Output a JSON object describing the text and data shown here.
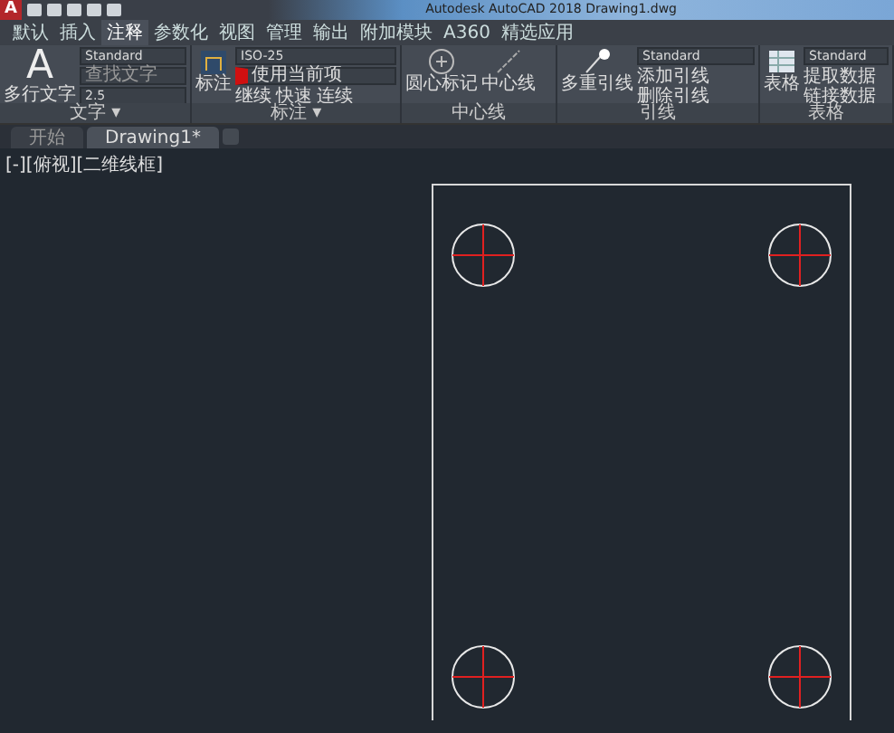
{
  "window": {
    "title": "Autodesk AutoCAD 2018    Drawing1.dwg",
    "app_button": "A"
  },
  "ribbon_tabs": [
    {
      "label": "默认",
      "selected": false
    },
    {
      "label": "插入",
      "selected": false
    },
    {
      "label": "注释",
      "selected": true
    },
    {
      "label": "参数化",
      "selected": false
    },
    {
      "label": "视图",
      "selected": false
    },
    {
      "label": "管理",
      "selected": false
    },
    {
      "label": "输出",
      "selected": false
    },
    {
      "label": "附加模块",
      "selected": false
    },
    {
      "label": "A360",
      "selected": false
    },
    {
      "label": "精选应用",
      "selected": false
    }
  ],
  "panels": [
    {
      "kind": "text",
      "title": "文字 ▾",
      "icon": "A",
      "big": "多行文字",
      "fields": [
        "Standard",
        "查找文字",
        "2.5"
      ]
    },
    {
      "kind": "dim",
      "title": "标注 ▾",
      "big": "标注",
      "fields": [
        "ISO-25",
        "使用当前项"
      ],
      "tools": [
        "继续",
        "快速",
        "连续"
      ]
    },
    {
      "kind": "center",
      "title": "中心线",
      "tools": [
        "圆心标记",
        "中心线"
      ]
    },
    {
      "kind": "leader",
      "title": "引线",
      "big": "多重引线",
      "fields": [
        "Standard"
      ],
      "tools": [
        "添加引线",
        "删除引线"
      ]
    },
    {
      "kind": "table",
      "title": "表格",
      "big": "表格",
      "fields": [
        "Standard"
      ],
      "tools": [
        "提取数据",
        "链接数据"
      ]
    }
  ],
  "doc_tabs": [
    {
      "label": "开始",
      "selected": false
    },
    {
      "label": "Drawing1*",
      "selected": true
    }
  ],
  "viewport_label": "[-][俯视][二维线框]"
}
